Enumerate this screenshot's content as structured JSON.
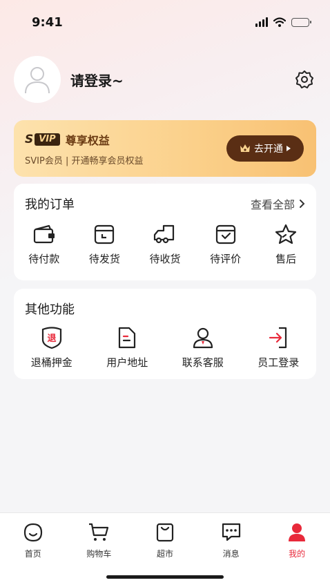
{
  "status": {
    "time": "9:41"
  },
  "profile": {
    "login_label": "请登录~"
  },
  "vip": {
    "badge_s": "S",
    "badge_vip": "VIP",
    "title": "尊享权益",
    "subtitle": "SVIP会员 | 开通畅享会员权益",
    "button_label": "去开通",
    "colors": {
      "card": "#fbd08a",
      "button": "#5a2e14"
    }
  },
  "orders": {
    "title": "我的订单",
    "view_all": "查看全部",
    "items": [
      {
        "label": "待付款",
        "icon": "wallet-icon"
      },
      {
        "label": "待发货",
        "icon": "box-icon"
      },
      {
        "label": "待收货",
        "icon": "truck-icon"
      },
      {
        "label": "待评价",
        "icon": "review-box-icon"
      },
      {
        "label": "售后",
        "icon": "star-icon"
      }
    ]
  },
  "others": {
    "title": "其他功能",
    "items": [
      {
        "label": "退桶押金",
        "icon": "refund-shield-icon"
      },
      {
        "label": "用户地址",
        "icon": "document-icon"
      },
      {
        "label": "联系客服",
        "icon": "customer-service-icon"
      },
      {
        "label": "员工登录",
        "icon": "login-icon"
      }
    ]
  },
  "tabbar": {
    "items": [
      {
        "label": "首页",
        "icon": "home-icon",
        "active": false
      },
      {
        "label": "购物车",
        "icon": "cart-icon",
        "active": false
      },
      {
        "label": "超市",
        "icon": "shopping-bag-icon",
        "active": false
      },
      {
        "label": "消息",
        "icon": "message-icon",
        "active": false
      },
      {
        "label": "我的",
        "icon": "profile-icon",
        "active": true
      }
    ],
    "active_color": "#e8293a"
  }
}
